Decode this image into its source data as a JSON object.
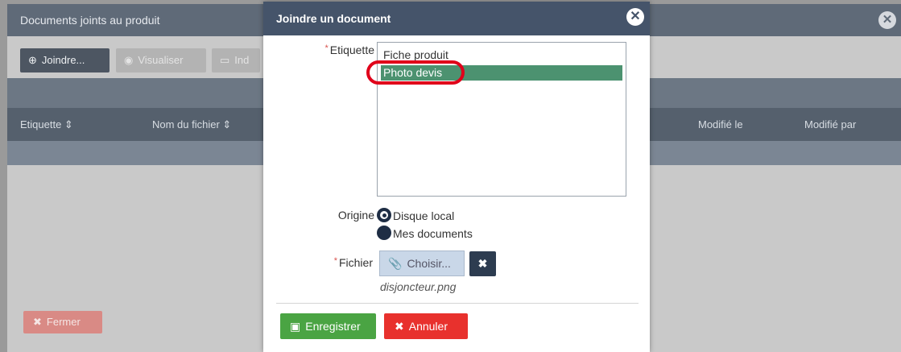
{
  "background_window": {
    "title": "Documents joints au produit",
    "close_icon": "close-circle-icon",
    "toolbar": {
      "join_label": "Joindre...",
      "join_icon": "plus-circle-icon",
      "view_label": "Visualiser",
      "view_icon": "eye-icon",
      "ind_label": "Ind",
      "ind_icon": "keyboard-icon"
    },
    "table_columns": [
      "Etiquette ⇕",
      "Nom du fichier ⇕",
      "Modifié le",
      "Modifié par"
    ],
    "close_button_label": "Fermer"
  },
  "modal": {
    "title": "Joindre un document",
    "etiquette_label": "Etiquette",
    "etiquette_options": [
      "Fiche produit",
      "Photo devis"
    ],
    "etiquette_selected": "Photo devis",
    "origine_label": "Origine",
    "origine_options": [
      "Disque local",
      "Mes documents"
    ],
    "origine_selected": "Disque local",
    "fichier_label": "Fichier",
    "choose_label": "Choisir...",
    "file_name": "disjoncteur.png",
    "save_label": "Enregistrer",
    "cancel_label": "Annuler"
  },
  "colors": {
    "header": "#45546a",
    "selected_option": "#4c9270",
    "save": "#4aa443",
    "cancel": "#e8312d",
    "highlight": "#e0001a"
  }
}
